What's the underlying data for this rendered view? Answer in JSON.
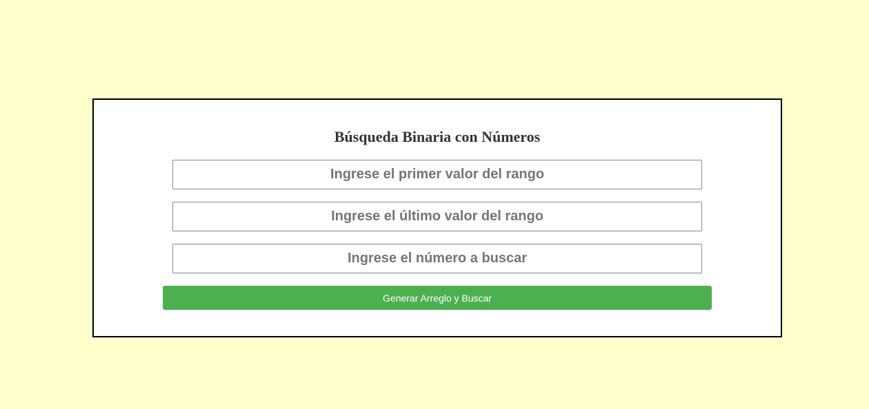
{
  "page": {
    "title": "Búsqueda Binaria con Números"
  },
  "form": {
    "first_value": {
      "value": "",
      "placeholder": "Ingrese el primer valor del rango"
    },
    "last_value": {
      "value": "",
      "placeholder": "Ingrese el último valor del rango"
    },
    "search_number": {
      "value": "",
      "placeholder": "Ingrese el número a buscar"
    },
    "submit_label": "Generar Arreglo y Buscar"
  },
  "colors": {
    "background": "#ffffcc",
    "card": "#ffffff",
    "button": "#4caf50"
  }
}
